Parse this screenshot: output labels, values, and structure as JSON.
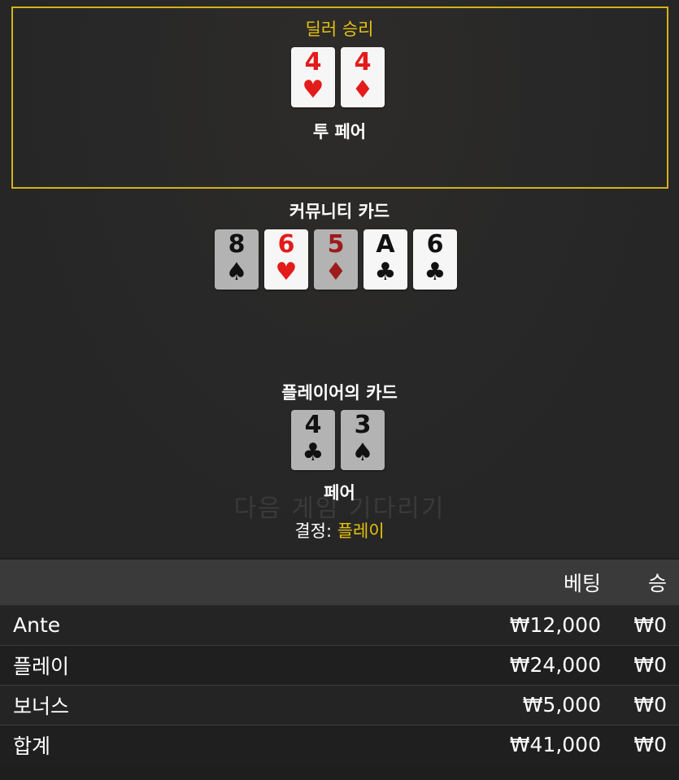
{
  "watermark": "다음 게임 기다리기",
  "dealer": {
    "result": "딜러 승리",
    "hand_name": "투 페어",
    "cards": [
      {
        "rank": "4",
        "suit": "♥",
        "color": "red",
        "dim": false
      },
      {
        "rank": "4",
        "suit": "♦",
        "color": "red",
        "dim": false
      }
    ]
  },
  "community": {
    "title": "커뮤니티 카드",
    "cards": [
      {
        "rank": "8",
        "suit": "♠",
        "color": "black",
        "dim": true
      },
      {
        "rank": "6",
        "suit": "♥",
        "color": "red",
        "dim": false
      },
      {
        "rank": "5",
        "suit": "♦",
        "color": "red",
        "dim": true
      },
      {
        "rank": "A",
        "suit": "♣",
        "color": "black",
        "dim": false
      },
      {
        "rank": "6",
        "suit": "♣",
        "color": "black",
        "dim": false
      }
    ]
  },
  "player": {
    "title": "플레이어의 카드",
    "hand_name": "페어",
    "decision_label": "결정:",
    "decision_value": "플레이",
    "cards": [
      {
        "rank": "4",
        "suit": "♣",
        "color": "black",
        "dim": true
      },
      {
        "rank": "3",
        "suit": "♠",
        "color": "black",
        "dim": true
      }
    ]
  },
  "bets_table": {
    "headers": {
      "bet": "베팅",
      "win": "승"
    },
    "rows": [
      {
        "name": "Ante",
        "bet": "₩12,000",
        "win": "₩0"
      },
      {
        "name": "플레이",
        "bet": "₩24,000",
        "win": "₩0"
      },
      {
        "name": "보너스",
        "bet": "₩5,000",
        "win": "₩0"
      }
    ],
    "total": {
      "name": "합계",
      "bet": "₩41,000",
      "win": "₩0"
    }
  },
  "colors": {
    "accent_gold": "#e6c20f",
    "card_red": "#e41b1b",
    "background": "#1e1e1e"
  }
}
